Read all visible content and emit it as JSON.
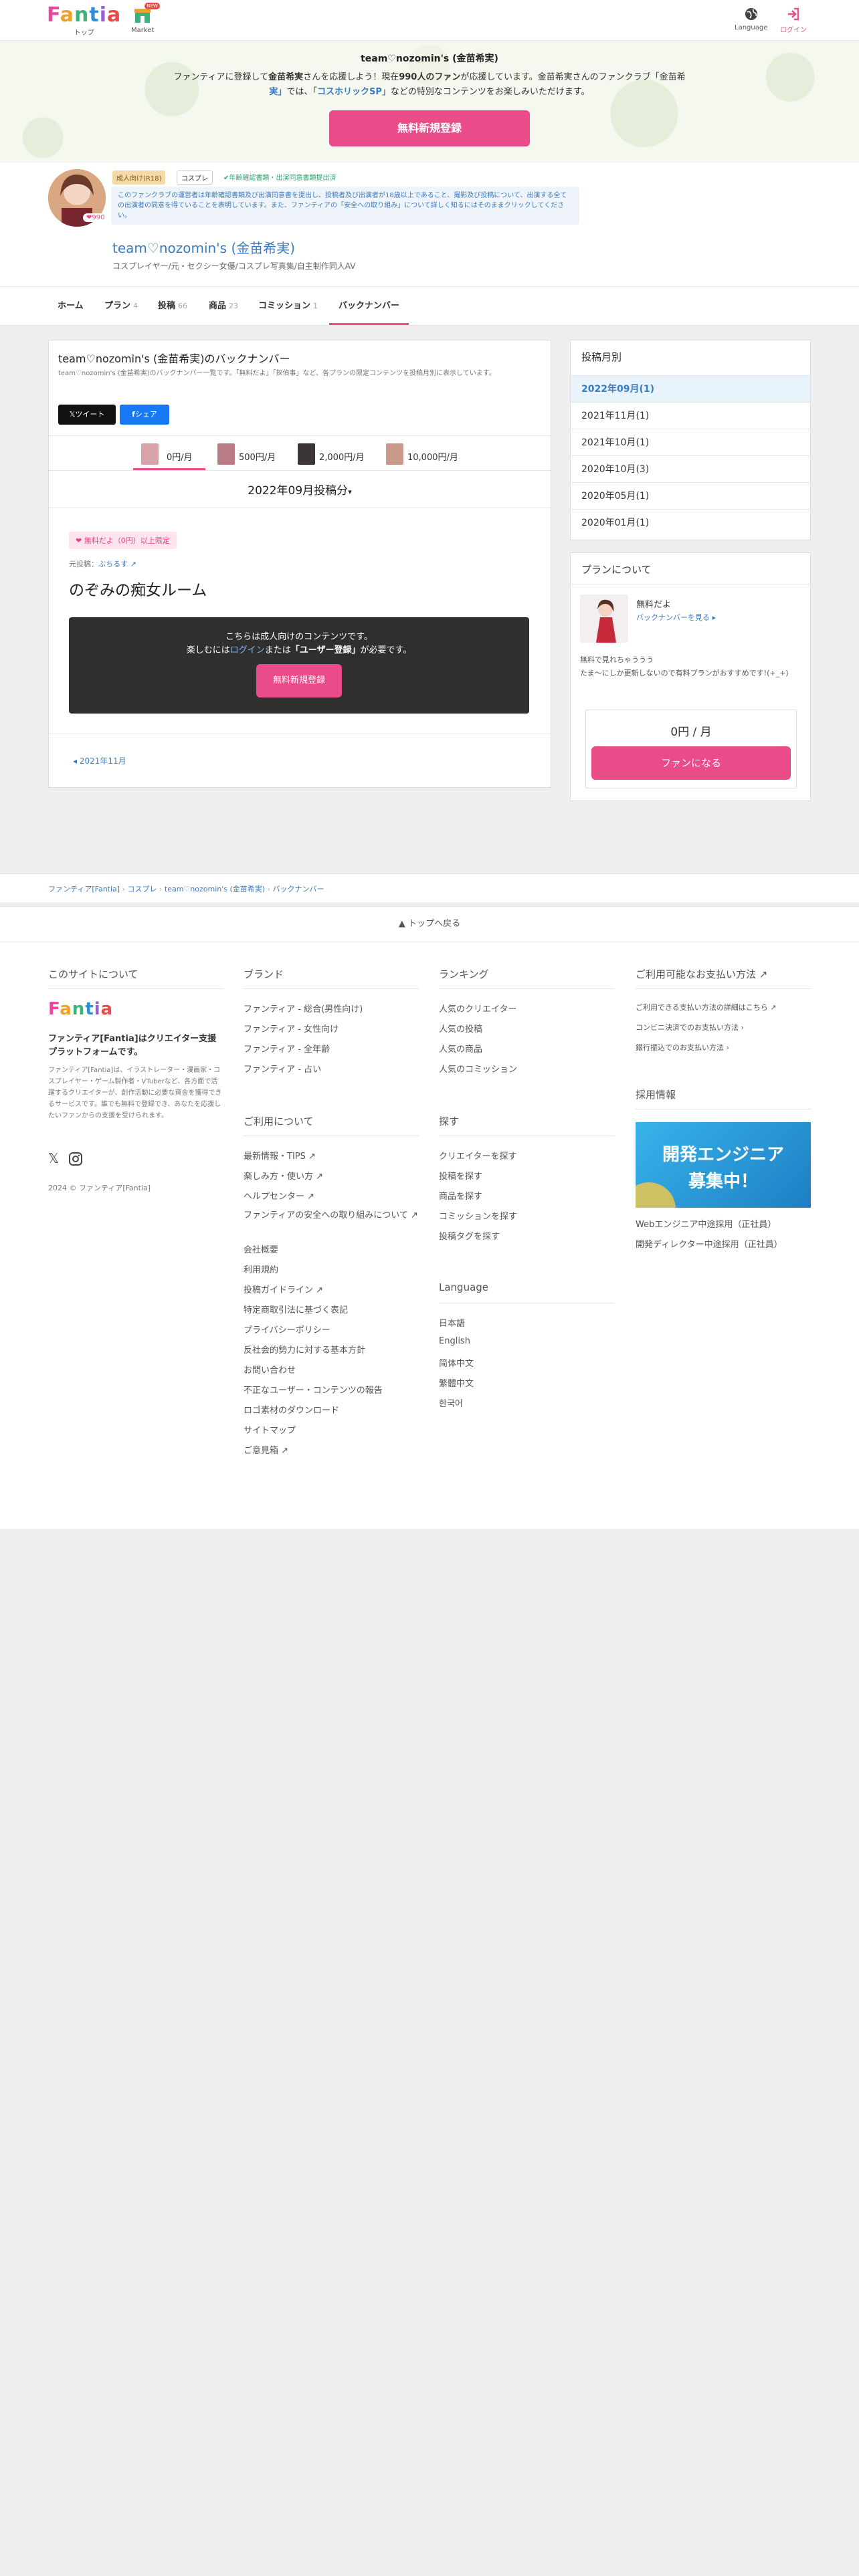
{
  "header": {
    "logo": "Fantia",
    "top_label": "トップ",
    "market_label": "Market",
    "market_badge": "NEW",
    "language_label": "Language",
    "login_label": "ログイン"
  },
  "banner": {
    "title": "team♡nozomin's (金苗希実)",
    "line1_a": "ファンティアに登録して",
    "line1_b": "金苗希実",
    "line1_c": "さんを応援しよう！現在",
    "line1_d": "990人のファン",
    "line1_e": "が応援しています。金苗希実さんのファンクラブ「金苗希",
    "line2_a": "実」",
    "line2_b": "では、「",
    "line2_c": "コスホリックSP",
    "line2_d": "」などの特別なコンテンツをお楽しみいただけます。",
    "cta": "無料新規登録"
  },
  "profile": {
    "fan_count": "990",
    "badge_r18": "成人向け(R18)",
    "badge_category": "コスプレ",
    "badge_verified": "✔年齢確認書類・出演同意書類提出済",
    "notice": "このファンクラブの運営者は年齢確認書類及び出演同意書を提出し、投稿者及び出演者が18歳以上であること、撮影及び投稿について、出演する全ての出演者の同意を得ていることを表明しています。また、ファンティアの「安全への取り組み」について詳しく知るにはそのままクリックしてください。",
    "name": "team♡nozomin's (金苗希実)",
    "tagline": "コスプレイヤー/元・セクシー女優/コスプレ写真集/自主制作同人AV"
  },
  "tabs": [
    {
      "label": "ホーム",
      "count": ""
    },
    {
      "label": "プラン",
      "count": "4"
    },
    {
      "label": "投稿",
      "count": "66"
    },
    {
      "label": "商品",
      "count": "23"
    },
    {
      "label": "コミッション",
      "count": "1"
    },
    {
      "label": "バックナンバー",
      "count": ""
    }
  ],
  "main": {
    "title": "team♡nozomin's (金苗希実)のバックナンバー",
    "desc": "team♡nozomin's (金苗希実)のバックナンバー一覧です。「無料だよ」「探偵事」など、各プランの限定コンテンツを投稿月別に表示しています。",
    "tweet": "𝕏ツイート",
    "share": "シェア",
    "plans": [
      {
        "price": "0円/月"
      },
      {
        "price": "500円/月"
      },
      {
        "price": "2,000円/月"
      },
      {
        "price": "10,000円/月"
      }
    ],
    "month_heading": "2022年09月投稿分",
    "plan_tag": "無料だよ（0円）以上限定",
    "origin_label": "元投稿：",
    "origin_link": "ぶちるす",
    "post_title": "のぞみの痴女ルーム",
    "adult_line1": "こちらは成人向けのコンテンツです。",
    "adult_line2_a": "楽しむには",
    "adult_line2_b": "ログイン",
    "adult_line2_c": "または",
    "adult_line2_d": "「ユーザー登録」",
    "adult_line2_e": "が必要です。",
    "adult_cta": "無料新規登録",
    "prev_link": "2021年11月"
  },
  "sidebar": {
    "archive_title": "投稿月別",
    "months": [
      "2022年09月(1)",
      "2021年11月(1)",
      "2021年10月(1)",
      "2020年10月(3)",
      "2020年05月(1)",
      "2020年01月(1)"
    ],
    "plan_title": "プランについて",
    "plan_name": "無料だよ",
    "plan_backnumber": "バックナンバーを見る",
    "plan_desc": "無料で見れちゃううう\nたま～にしか更新しないので有料プランがおすすめです!(+_+)",
    "plan_price": "0円 / 月",
    "plan_cta": "ファンになる"
  },
  "breadcrumb": [
    "ファンティア[Fantia]",
    "コスプレ",
    "team♡nozomin's (金苗希実)",
    "バックナンバー"
  ],
  "to_top": "トップへ戻る",
  "footer": {
    "about_title": "このサイトについて",
    "about_bold": "ファンティア[Fantia]はクリエイター支援プラットフォームです。",
    "about_text": "ファンティア[Fantia]は、イラストレーター・漫画家・コスプレイヤー・ゲーム製作者・VTuberなど、各方面で活躍するクリエイターが、創作活動に必要な資金を獲得できるサービスです。誰でも無料で登録でき、あなたを応援したいファンからの支援を受けられます。",
    "copyright": "2024 © ファンティア[Fantia]",
    "brand_title": "ブランド",
    "brand_links": [
      "ファンティア - 総合(男性向け)",
      "ファンティア - 女性向け",
      "ファンティア - 全年齢",
      "ファンティア - 占い"
    ],
    "usage_title": "ご利用について",
    "usage_links": [
      "最新情報・TIPS",
      "楽しみ方・使い方",
      "ヘルプセンター",
      "ファンティアの安全への取り組みについて",
      "会社概要",
      "利用規約",
      "投稿ガイドライン",
      "特定商取引法に基づく表記",
      "プライバシーポリシー",
      "反社会的勢力に対する基本方針",
      "お問い合わせ",
      "不正なユーザー・コンテンツの報告",
      "ロゴ素材のダウンロード",
      "サイトマップ",
      "ご意見箱"
    ],
    "ranking_title": "ランキング",
    "ranking_links": [
      "人気のクリエイター",
      "人気の投稿",
      "人気の商品",
      "人気のコミッション"
    ],
    "explore_title": "探す",
    "explore_links": [
      "クリエイターを探す",
      "投稿を探す",
      "商品を探す",
      "コミッションを探す",
      "投稿タグを探す"
    ],
    "language_title": "Language",
    "languages": [
      "日本語",
      "English",
      "简体中文",
      "繁體中文",
      "한국어"
    ],
    "payment_title": "ご利用可能なお支払い方法",
    "payment_links": [
      "ご利用できる支払い方法の詳細はこちら",
      "コンビニ決済でのお支払い方法",
      "銀行振込でのお支払い方法"
    ],
    "recruit_title": "採用情報",
    "recruit_banner_line1": "開発エンジニア",
    "recruit_banner_line2": "募集中！",
    "recruit_links": [
      "Webエンジニア中途採用（正社員）",
      "開発ディレクター中途採用（正社員）"
    ]
  }
}
